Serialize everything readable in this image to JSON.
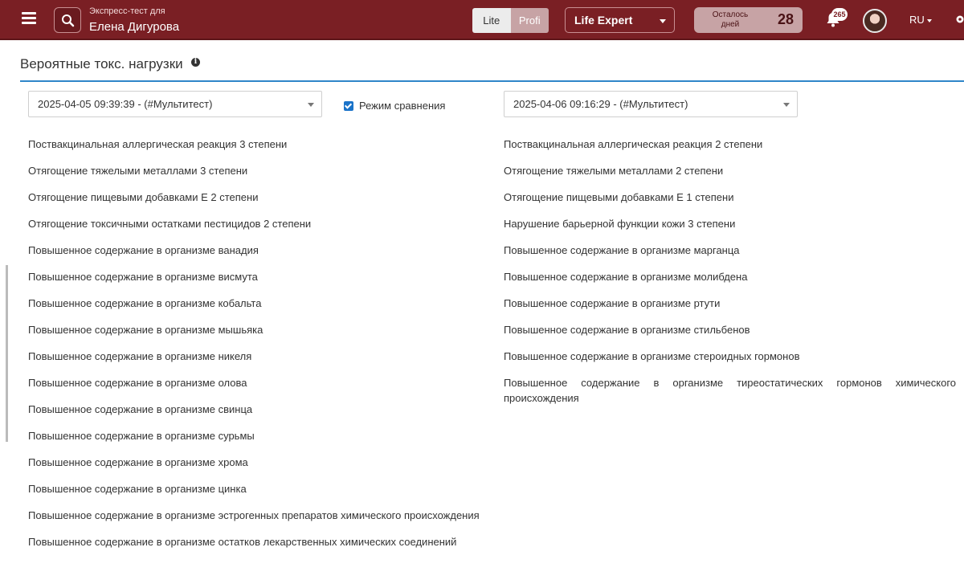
{
  "header": {
    "subtitle": "Экспресс-тест для",
    "client_name": "Елена Дигурова",
    "modes": {
      "lite": "Lite",
      "profi": "Profi"
    },
    "product": "Life Expert",
    "days_label": "Осталось дней",
    "days_left": "28",
    "notifications_count": "265",
    "language": "RU",
    "icons": [
      "menu-icon",
      "search-icon",
      "bell-icon",
      "avatar",
      "gear-icon"
    ]
  },
  "page": {
    "title": "Вероятные токс. нагрузки",
    "compare_label": "Режим сравнения",
    "compare_checked": true
  },
  "left": {
    "date": "2025-04-05 09:39:39 - (#Мультитест)",
    "items": [
      "Поствакцинальная аллергическая реакция 3 степени",
      "Отягощение тяжелыми металлами 3 степени",
      "Отягощение пищевыми добавками Е 2 степени",
      "Отягощение токсичными остатками пестицидов 2 степени",
      "Повышенное содержание в организме ванадия",
      "Повышенное содержание в организме висмута",
      "Повышенное содержание в организме кобальта",
      "Повышенное содержание в организме мышьяка",
      "Повышенное содержание в организме никеля",
      "Повышенное содержание в организме олова",
      "Повышенное содержание в организме свинца",
      "Повышенное содержание в организме сурьмы",
      "Повышенное содержание в организме хрома",
      "Повышенное содержание в организме цинка",
      "Повышенное содержание в организме эстрогенных препаратов химического происхождения",
      "Повышенное содержание в организме остатков лекарственных химических соединений"
    ]
  },
  "right": {
    "date": "2025-04-06 09:16:29 - (#Мультитест)",
    "items": [
      "Поствакцинальная аллергическая реакция 2 степени",
      "Отягощение тяжелыми металлами 2 степени",
      "Отягощение пищевыми добавками Е 1 степени",
      "Нарушение барьерной функции кожи 3 степени",
      "Повышенное содержание в организме марганца",
      "Повышенное содержание в организме молибдена",
      "Повышенное содержание в организме ртути",
      "Повышенное содержание в организме стильбенов",
      "Повышенное содержание в организме стероидных гормонов",
      "Повышенное содержание в организме тиреостатических гормонов химического происхождения"
    ]
  },
  "colors": {
    "header_bg": "#7a1f24",
    "accent_line": "#2f86c9",
    "checkbox": "#1a73c9"
  }
}
